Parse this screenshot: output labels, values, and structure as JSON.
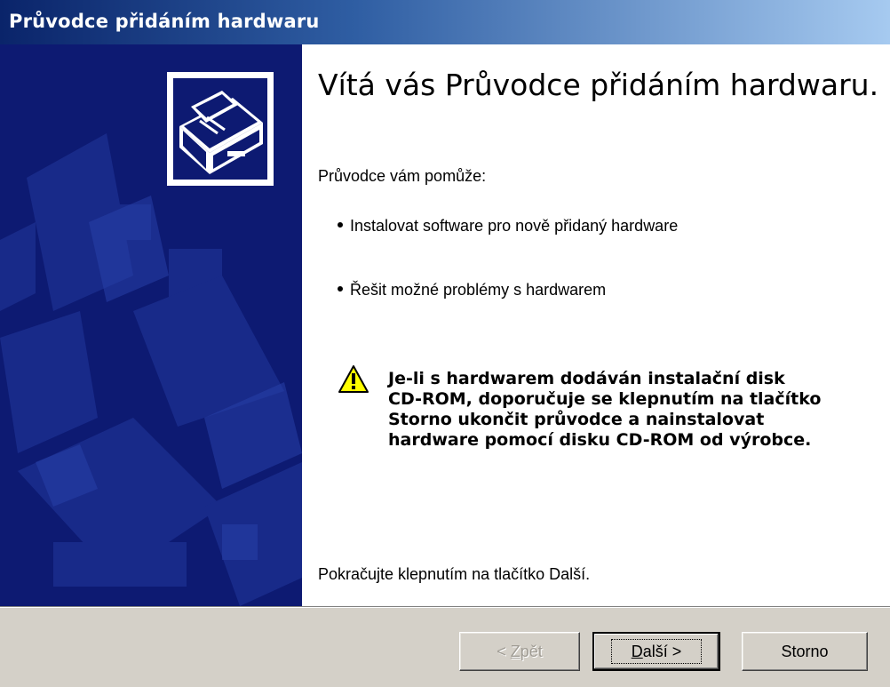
{
  "window": {
    "title": "Průvodce přidáním hardwaru"
  },
  "heading": "Vítá vás Průvodce přidáním hardwaru.",
  "intro": "Průvodce vám pomůže:",
  "bullets": [
    "Instalovat software pro nově přidaný hardware",
    "Řešit možné problémy s hardwarem"
  ],
  "warning": {
    "icon": "warning-icon",
    "lines": [
      "Je-li s hardwarem dodáván instalační disk",
      "CD-ROM, doporučuje se klepnutím na tlačítko",
      "Storno ukončit průvodce a nainstalovat",
      "hardware pomocí disku CD-ROM od výrobce."
    ]
  },
  "footer_text": "Pokračujte klepnutím na tlačítko Další.",
  "buttons": {
    "back": {
      "prefix": "< ",
      "mnemonic": "Z",
      "rest": "pět",
      "enabled": false
    },
    "next": {
      "mnemonic": "D",
      "rest": "alší >",
      "default": true
    },
    "cancel": {
      "label": "Storno"
    }
  },
  "colors": {
    "banner": "#0d1a72",
    "titlebar_start": "#0a246a",
    "titlebar_end": "#a6caf0",
    "dialog_face": "#d4d0c8"
  }
}
